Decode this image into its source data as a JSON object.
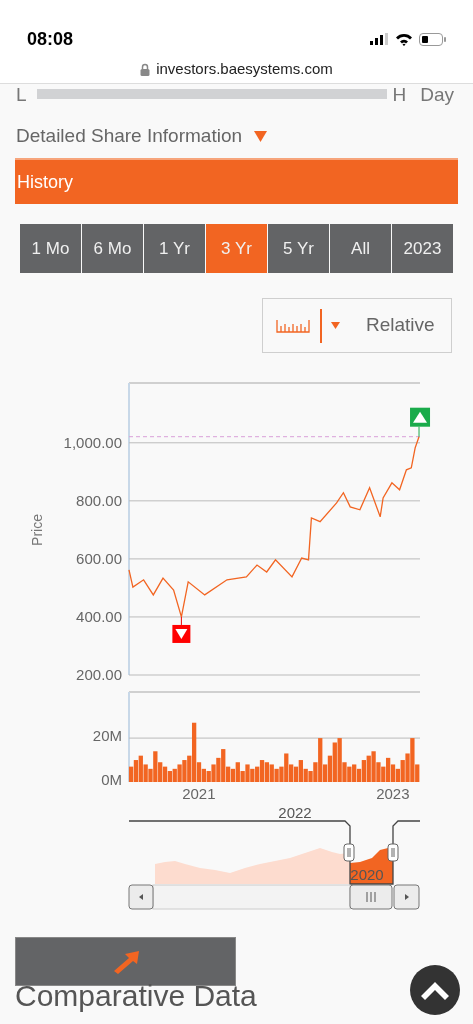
{
  "status_bar": {
    "time": "08:08"
  },
  "browser": {
    "url": "investors.baesystems.com"
  },
  "range_row": {
    "low": "L",
    "high": "H",
    "period": "Day"
  },
  "section_heading": {
    "text": "Detailed Share Information",
    "expanded": true
  },
  "section_bar": {
    "title": "History"
  },
  "period_tabs": [
    {
      "label": "1 Mo",
      "selected": false
    },
    {
      "label": "6 Mo",
      "selected": false
    },
    {
      "label": "1 Yr",
      "selected": false
    },
    {
      "label": "3 Yr",
      "selected": true
    },
    {
      "label": "5 Yr",
      "selected": false
    },
    {
      "label": "All",
      "selected": false
    },
    {
      "label": "2023",
      "selected": false
    }
  ],
  "chart_type_dropdown": {
    "label": "Relative"
  },
  "price_chart": {
    "chart_data": {
      "type": "line",
      "ylabel": "Price",
      "x": [
        2020.28,
        2020.32,
        2020.43,
        2020.53,
        2020.63,
        2020.74,
        2020.82,
        2020.89,
        2021.06,
        2021.29,
        2021.49,
        2021.6,
        2021.7,
        2021.79,
        2021.96,
        2022.06,
        2022.13,
        2022.16,
        2022.25,
        2022.42,
        2022.49,
        2022.56,
        2022.66,
        2022.76,
        2022.87,
        2022.9,
        2022.99,
        2023.07,
        2023.14,
        2023.19,
        2023.23,
        2023.27
      ],
      "series": [
        {
          "color": "#f26522",
          "values": [
            562,
            503,
            528,
            476,
            534,
            493,
            400,
            521,
            476,
            528,
            538,
            579,
            555,
            597,
            538,
            603,
            597,
            741,
            728,
            793,
            828,
            779,
            769,
            845,
            745,
            810,
            862,
            838,
            907,
            914,
            983,
            1021
          ]
        }
      ],
      "xlim": [
        2020.28,
        2023.28
      ],
      "ylim": [
        200,
        1206
      ],
      "grid": true,
      "ref_lines": [
        {
          "axis": "y",
          "value": 1021
        }
      ],
      "yticks": [
        {
          "value": 200,
          "label": "200.00"
        },
        {
          "value": 400,
          "label": "400.00"
        },
        {
          "value": 600,
          "label": "600.00"
        },
        {
          "value": 800,
          "label": "800.00"
        },
        {
          "value": 1000,
          "label": "1,000.00"
        }
      ]
    }
  },
  "volume_chart": {
    "chart_data": {
      "type": "bar",
      "x": [
        2020.3,
        2020.35,
        2020.4,
        2020.45,
        2020.5,
        2020.55,
        2020.6,
        2020.65,
        2020.7,
        2020.75,
        2020.8,
        2020.85,
        2020.9,
        2020.95,
        2021.0,
        2021.05,
        2021.1,
        2021.15,
        2021.2,
        2021.25,
        2021.3,
        2021.35,
        2021.4,
        2021.45,
        2021.5,
        2021.55,
        2021.6,
        2021.65,
        2021.7,
        2021.75,
        2021.8,
        2021.85,
        2021.9,
        2021.95,
        2022.0,
        2022.05,
        2022.1,
        2022.15,
        2022.2,
        2022.25,
        2022.3,
        2022.35,
        2022.4,
        2022.45,
        2022.5,
        2022.55,
        2022.6,
        2022.65,
        2022.7,
        2022.75,
        2022.8,
        2022.85,
        2022.9,
        2022.95,
        2023.0,
        2023.05,
        2023.1,
        2023.15,
        2023.2,
        2023.25
      ],
      "series": [
        {
          "color": "#f26522",
          "values": [
            7,
            10,
            12,
            8,
            6,
            14,
            9,
            7,
            5,
            6,
            8,
            10,
            12,
            27,
            9,
            6,
            5,
            8,
            11,
            15,
            7,
            6,
            9,
            5,
            8,
            6,
            7,
            10,
            9,
            8,
            6,
            7,
            13,
            8,
            7,
            10,
            6,
            5,
            9,
            20,
            8,
            12,
            18,
            20,
            9,
            7,
            8,
            6,
            10,
            12,
            14,
            9,
            7,
            11,
            8,
            6,
            10,
            13,
            20,
            8
          ]
        }
      ],
      "xlim": [
        2020.28,
        2023.28
      ],
      "ylim": [
        0,
        41
      ],
      "grid": true,
      "yticks": [
        {
          "value": 0,
          "label": "0M"
        },
        {
          "value": 20,
          "label": "20M"
        }
      ],
      "xticks": [
        {
          "value": 2021,
          "label": "2021"
        },
        {
          "value": 2023,
          "label": "2023"
        }
      ]
    }
  },
  "navigator": {
    "top_label": "2022",
    "selected_label": "2020"
  },
  "next_heading": {
    "text": "Comparative Data"
  }
}
